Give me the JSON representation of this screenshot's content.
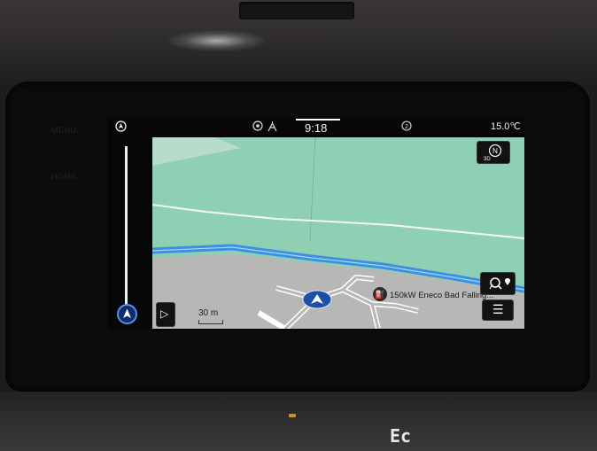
{
  "status_bar": {
    "time": "9:18",
    "temperature": "15.0℃",
    "left_icon": "navigation-arrow-icon",
    "center_icons": [
      "phone-settings-icon",
      "connectivity-icon"
    ],
    "right_icon": "badge-2-icon"
  },
  "hardware_keys": {
    "menu": "MENU",
    "home": "HOME"
  },
  "map": {
    "compass_mode": "3D",
    "compass_north": "N",
    "poi": {
      "icon": "ev-charging-icon",
      "icon_glyph": "⛽",
      "label": "150kW Eneco Bad Falling..."
    },
    "scale": "30 m",
    "colors": {
      "land": "#8fd0b5",
      "road_highlight": "#3e8fe0",
      "built_area": "#b7b7b5",
      "vehicle_marker": "#1d4fa5"
    }
  },
  "buttons": {
    "menu_icon": "☰",
    "guidance_icon": "▷",
    "search_icon": "search-map-icon"
  },
  "bottom_display": "Ec"
}
